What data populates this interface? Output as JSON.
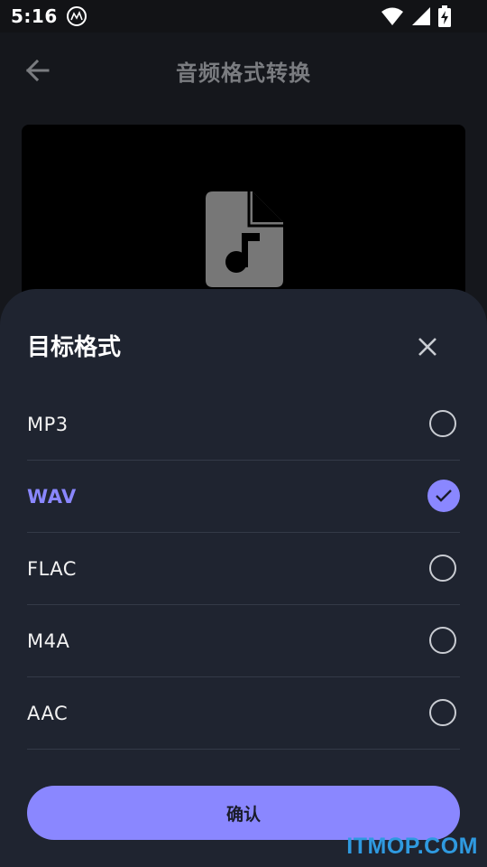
{
  "status_bar": {
    "time": "5:16",
    "app_icon": "notification-app-icon",
    "icons": [
      "wifi-icon",
      "signal-icon",
      "battery-charging-icon"
    ]
  },
  "app_bar": {
    "title": "音频格式转换",
    "back_icon": "arrow-left-icon"
  },
  "preview": {
    "icon": "audio-file-icon"
  },
  "sheet": {
    "title": "目标格式",
    "close_icon": "close-icon",
    "options": [
      {
        "label": "MP3",
        "selected": false
      },
      {
        "label": "WAV",
        "selected": true
      },
      {
        "label": "FLAC",
        "selected": false
      },
      {
        "label": "M4A",
        "selected": false
      },
      {
        "label": "AAC",
        "selected": false
      }
    ],
    "confirm_label": "确认"
  },
  "watermark": "ITMOP.COM",
  "colors": {
    "accent": "#8a87ff",
    "sheet_bg": "#1f2430",
    "divider": "#343a47",
    "watermark": "#2f9ae0"
  }
}
